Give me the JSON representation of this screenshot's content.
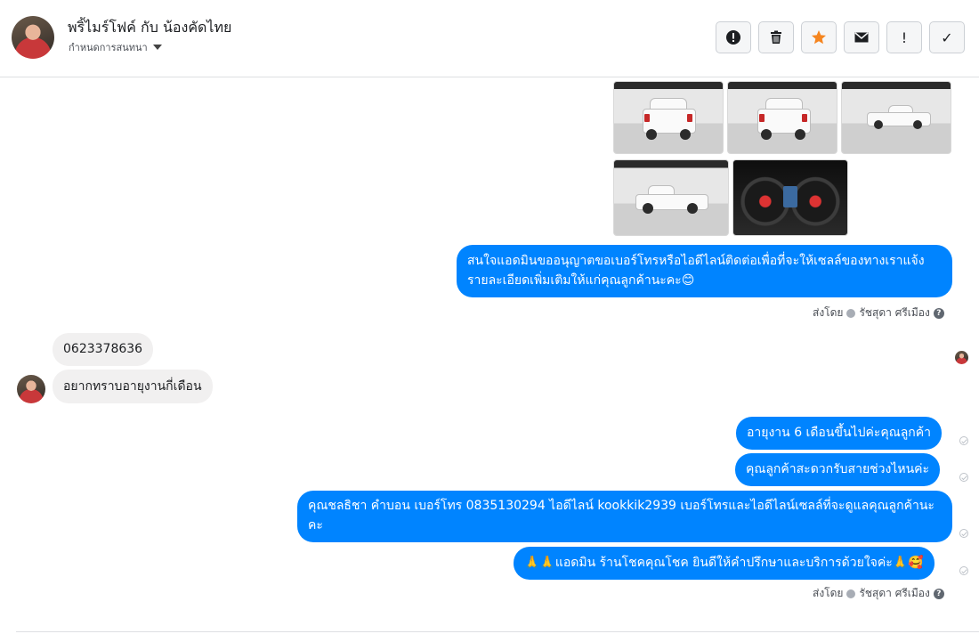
{
  "header": {
    "title": "พริ้ไมร์โฟค์ กับ น้องคัดไทย",
    "subtitle": "กำหนดการสนทนา",
    "actions": [
      {
        "name": "report",
        "icon": "alert-circle-icon",
        "glyph": "!"
      },
      {
        "name": "delete",
        "icon": "trash-icon"
      },
      {
        "name": "star",
        "icon": "star-icon",
        "color": "#f5851f"
      },
      {
        "name": "mail",
        "icon": "envelope-icon"
      },
      {
        "name": "spam",
        "icon": "exclamation-icon",
        "glyph": "!"
      },
      {
        "name": "done",
        "icon": "checkmark-icon",
        "glyph": "✓"
      }
    ]
  },
  "colors": {
    "outgoing_bubble": "#0084ff",
    "incoming_bubble": "#f1f0f0",
    "star": "#f5851f"
  },
  "messages": {
    "out_1": "สนใจแอดมินขออนุญาตขอเบอร์โทรหรือไอดีไลน์ติดต่อเพื่อที่จะให้เซลล์ของทางเราแจ้งรายละเอียดเพิ่มเติมให้แก่คุณลูกค้านะคะ😊",
    "meta_1": {
      "prefix": "ส่งโดย",
      "sender": "รัชสุดา ศรีเมือง"
    },
    "in_1": "0623378636",
    "in_2": "อยากทราบอายุงานกี่เดือน",
    "out_2": "อายุงาน 6 เดือนขึ้นไปค่ะคุณลูกค้า",
    "out_3": "คุณลูกค้าสะดวกรับสายช่วงไหนค่ะ",
    "out_4": "คุณชลธิชา คำบอน เบอร์โทร 0835130294  ไอดีไลน์ kookkik2939   เบอร์โทรและไอดีไลน์เซลล์ที่จะดูแลคุณลูกค้านะคะ",
    "out_5": "🙏🙏แอดมิน ร้านโชคคุณโชค ยินดีให้คำปรึกษาและบริการด้วยใจค่ะ🙏🥰",
    "meta_2": {
      "prefix": "ส่งโดย",
      "sender": "รัชสุดา ศรีเมือง"
    }
  }
}
